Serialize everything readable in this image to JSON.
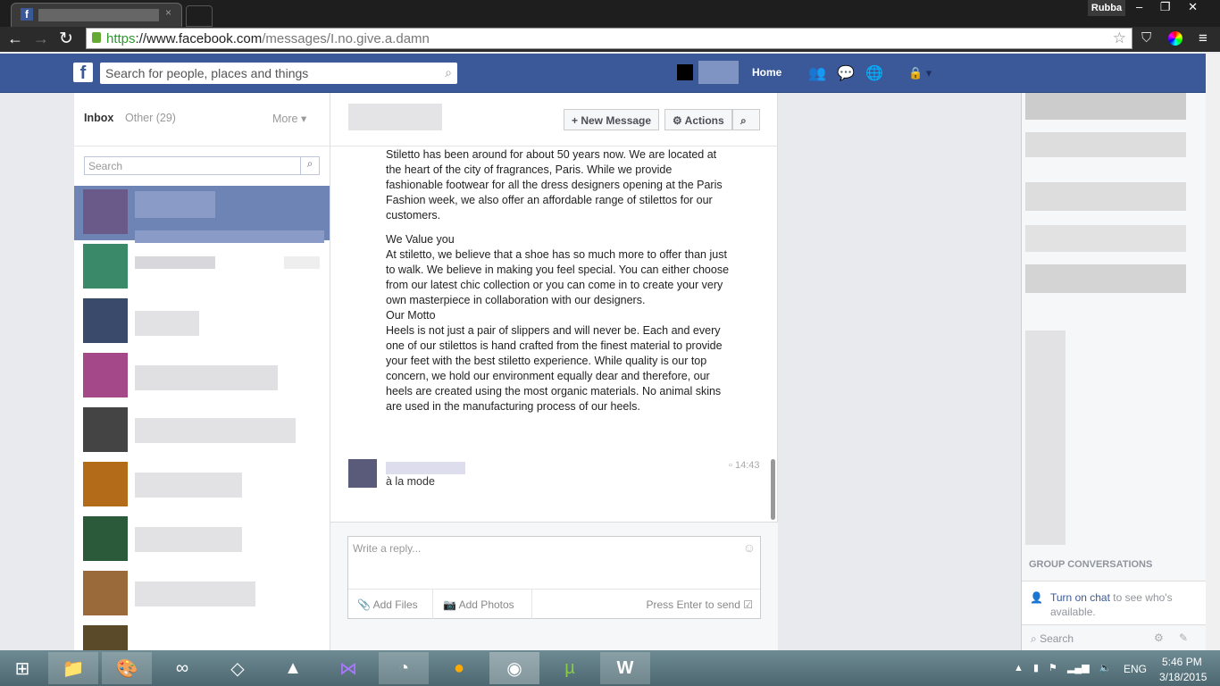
{
  "browser": {
    "url_scheme": "https",
    "url_host": "://www.facebook.com",
    "url_path": "/messages/I.no.give.a.damn",
    "user": "Rubba"
  },
  "fb": {
    "search_placeholder": "Search for people, places and things",
    "home": "Home"
  },
  "inbox": {
    "tab_inbox": "Inbox",
    "tab_other": "Other (29)",
    "more": "More ▾",
    "search_placeholder": "Search"
  },
  "conversation": {
    "new_message": "New Message",
    "actions": "Actions",
    "paragraphs": [
      "Stiletto has been around for about 50 years now. We are located at the heart of the city of fragrances, Paris. While we provide fashionable footwear for all the dress designers opening at the Paris Fashion week, we also offer an affordable range of stilettos for our customers.",
      "We Value you\nAt stiletto, we believe that a shoe has so much more to offer than just to walk. We believe in making you feel special. You can either choose from our latest chic collection or you can come in to create your very own masterpiece in collaboration with our designers.\nOur Motto\nHeels is not just a pair of slippers and will never be. Each and every one of our stilettos is hand crafted from the finest material to provide your feet with the best stiletto experience. While quality is our top concern, we hold our environment equally dear and therefore, our heels are created using the most organic materials. No animal skins are used in the manufacturing process of our heels."
    ],
    "last_message": "à la mode",
    "last_time": "14:43",
    "reply_placeholder": "Write a reply...",
    "add_files": "Add Files",
    "add_photos": "Add Photos",
    "press_enter": "Press Enter to send"
  },
  "chat": {
    "group_header": "GROUP CONVERSATIONS",
    "turn_on": "Turn on chat",
    "turn_on_rest": " to see who's available.",
    "search": "Search"
  },
  "taskbar": {
    "lang": "ENG",
    "time": "5:46 PM",
    "date": "3/18/2015"
  },
  "colors": {
    "fb_blue": "#3b5998",
    "selected_row": "#6d84b4"
  }
}
